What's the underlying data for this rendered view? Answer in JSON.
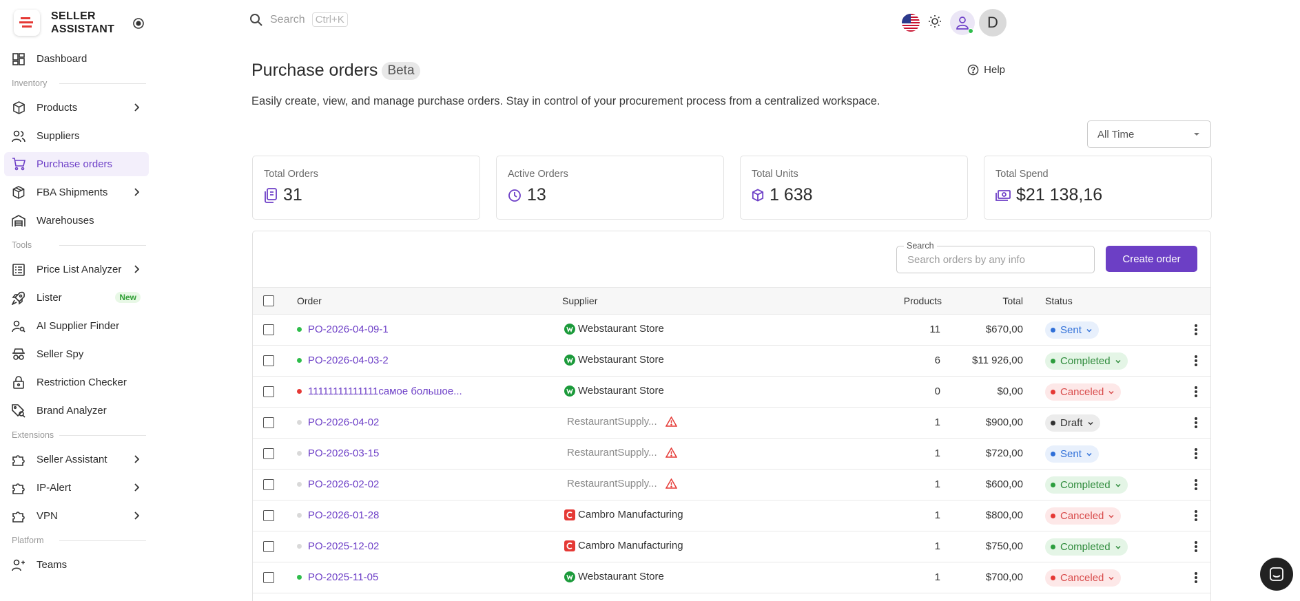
{
  "brand": {
    "line1": "SELLER",
    "line2": "ASSISTANT"
  },
  "sidebar": {
    "dashboard": "Dashboard",
    "section_inventory": "Inventory",
    "products": "Products",
    "suppliers": "Suppliers",
    "purchase_orders": "Purchase orders",
    "fba_shipments": "FBA Shipments",
    "warehouses": "Warehouses",
    "section_tools": "Tools",
    "price_list_analyzer": "Price List Analyzer",
    "lister": "Lister",
    "lister_badge": "New",
    "ai_supplier_finder": "AI Supplier Finder",
    "seller_spy": "Seller Spy",
    "restriction_checker": "Restriction Checker",
    "brand_analyzer": "Brand Analyzer",
    "section_extensions": "Extensions",
    "seller_assistant": "Seller Assistant",
    "ip_alert": "IP-Alert",
    "vpn": "VPN",
    "section_platform": "Platform",
    "teams": "Teams"
  },
  "topbar": {
    "search_placeholder": "Search",
    "shortcut": "Ctrl+K",
    "avatar_letter": "D"
  },
  "header": {
    "title": "Purchase orders",
    "beta": "Beta",
    "help": "Help",
    "description": "Easily create, view, and manage purchase orders. Stay in control of your procurement process from a centralized workspace.",
    "period": "All Time"
  },
  "stats": {
    "total_orders_label": "Total Orders",
    "total_orders": "31",
    "active_orders_label": "Active Orders",
    "active_orders": "13",
    "total_units_label": "Total Units",
    "total_units": "1 638",
    "total_spend_label": "Total Spend",
    "total_spend": "$21 138,16"
  },
  "table": {
    "search_label": "Search",
    "search_placeholder": "Search orders by any info",
    "create_button": "Create order",
    "headers": {
      "order": "Order",
      "supplier": "Supplier",
      "products": "Products",
      "total": "Total",
      "status": "Status"
    },
    "rows": [
      {
        "order": "PO-2026-04-09-1",
        "supplier": "Webstaurant Store",
        "products": "11",
        "total": "$670,00",
        "status": "Sent"
      },
      {
        "order": "PO-2026-04-03-2",
        "supplier": "Webstaurant Store",
        "products": "6",
        "total": "$11 926,00",
        "status": "Completed"
      },
      {
        "order": "11111111111111самое большое...",
        "supplier": "Webstaurant Store",
        "products": "0",
        "total": "$0,00",
        "status": "Canceled"
      },
      {
        "order": "PO-2026-04-02",
        "supplier": "RestaurantSupply...",
        "products": "1",
        "total": "$900,00",
        "status": "Draft"
      },
      {
        "order": "PO-2026-03-15",
        "supplier": "RestaurantSupply...",
        "products": "1",
        "total": "$720,00",
        "status": "Sent"
      },
      {
        "order": "PO-2026-02-02",
        "supplier": "RestaurantSupply...",
        "products": "1",
        "total": "$600,00",
        "status": "Completed"
      },
      {
        "order": "PO-2026-01-28",
        "supplier": "Cambro Manufacturing",
        "products": "1",
        "total": "$800,00",
        "status": "Canceled"
      },
      {
        "order": "PO-2025-12-02",
        "supplier": "Cambro Manufacturing",
        "products": "1",
        "total": "$750,00",
        "status": "Completed"
      },
      {
        "order": "PO-2025-11-05",
        "supplier": "Webstaurant Store",
        "products": "1",
        "total": "$700,00",
        "status": "Canceled"
      }
    ]
  },
  "colors": {
    "accent": "#6c3fc5",
    "sent": "#2f6fd8",
    "completed": "#2d8a3a",
    "canceled": "#d84a4a",
    "online": "#2fbd4b"
  }
}
